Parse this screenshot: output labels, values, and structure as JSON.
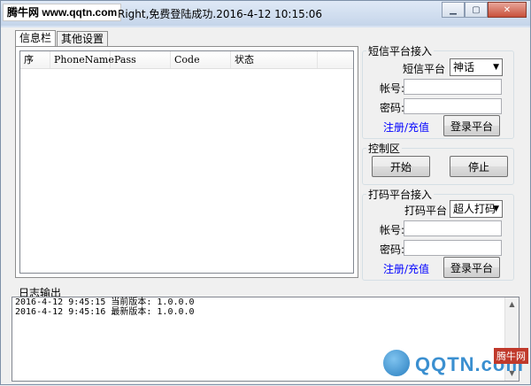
{
  "window": {
    "brand": "腾牛网 www.qqtn.com",
    "title": "Right,免费登陆成功.2016-4-12 10:15:06",
    "controls": [
      "minimize",
      "maximize",
      "close"
    ]
  },
  "tabs": [
    {
      "label": "信息栏",
      "active": true
    },
    {
      "label": "其他设置",
      "active": false
    }
  ],
  "list": {
    "columns": [
      "序",
      "PhoneName",
      "Pass",
      "Code",
      "状态"
    ],
    "rows": []
  },
  "sms": {
    "title": "短信平台接入",
    "platform_label": "短信平台",
    "platform_value": "神话",
    "account_label": "帐号:",
    "account_value": "",
    "password_label": "密码:",
    "password_value": "",
    "register_link": "注册/充值",
    "login_button": "登录平台"
  },
  "control": {
    "title": "控制区",
    "start_button": "开始",
    "stop_button": "停止"
  },
  "captcha": {
    "title": "打码平台接入",
    "platform_label": "打码平台",
    "platform_value": "超人打码",
    "account_label": "帐号:",
    "account_value": "",
    "password_label": "密码:",
    "password_value": "",
    "register_link": "注册/充值",
    "login_button": "登录平台"
  },
  "log": {
    "title": "日志输出",
    "lines": [
      "2016-4-12 9:45:15 当前版本: 1.0.0.0",
      "2016-4-12 9:45:16 最新版本: 1.0.0.0"
    ]
  },
  "watermark": {
    "text": "QQTN.com",
    "tag": "腾牛网"
  }
}
